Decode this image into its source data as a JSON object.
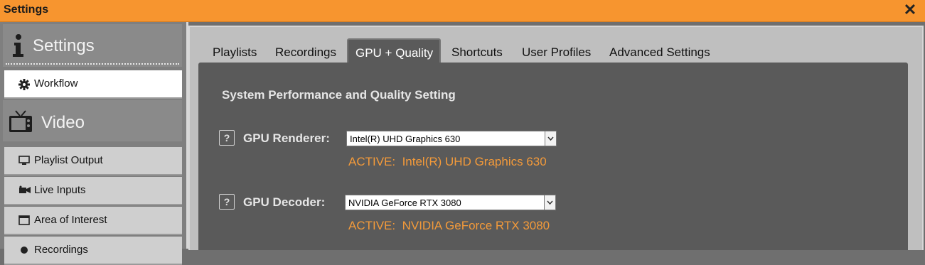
{
  "window": {
    "title": "Settings"
  },
  "sidebar": {
    "sections": [
      {
        "label": "Settings",
        "icon": "info-icon"
      },
      {
        "label": "Video",
        "icon": "tv-icon"
      }
    ],
    "items": [
      {
        "label": "Workflow",
        "icon": "gear-icon",
        "active": true
      },
      {
        "label": "Playlist Output",
        "icon": "monitor-icon"
      },
      {
        "label": "Live Inputs",
        "icon": "camera-icon"
      },
      {
        "label": "Area of Interest",
        "icon": "window-icon"
      },
      {
        "label": "Recordings",
        "icon": "record-icon"
      }
    ]
  },
  "tabs": [
    {
      "label": "Playlists"
    },
    {
      "label": "Recordings"
    },
    {
      "label": "GPU + Quality",
      "active": true
    },
    {
      "label": "Shortcuts"
    },
    {
      "label": "User Profiles"
    },
    {
      "label": "Advanced Settings"
    }
  ],
  "panel": {
    "title": "System Performance and Quality Setting",
    "help_label": "?",
    "renderer": {
      "label": "GPU Renderer:",
      "value": "Intel(R) UHD Graphics 630",
      "active_prefix": "ACTIVE:",
      "active_value": "Intel(R) UHD Graphics 630"
    },
    "decoder": {
      "label": "GPU Decoder:",
      "value": "NVIDIA GeForce RTX 3080",
      "active_prefix": "ACTIVE:",
      "active_value": "NVIDIA GeForce RTX 3080"
    }
  },
  "colors": {
    "titlebar": "#f7952f",
    "accent_text": "#f39a3a",
    "panel_bg": "#5a5a5a"
  }
}
